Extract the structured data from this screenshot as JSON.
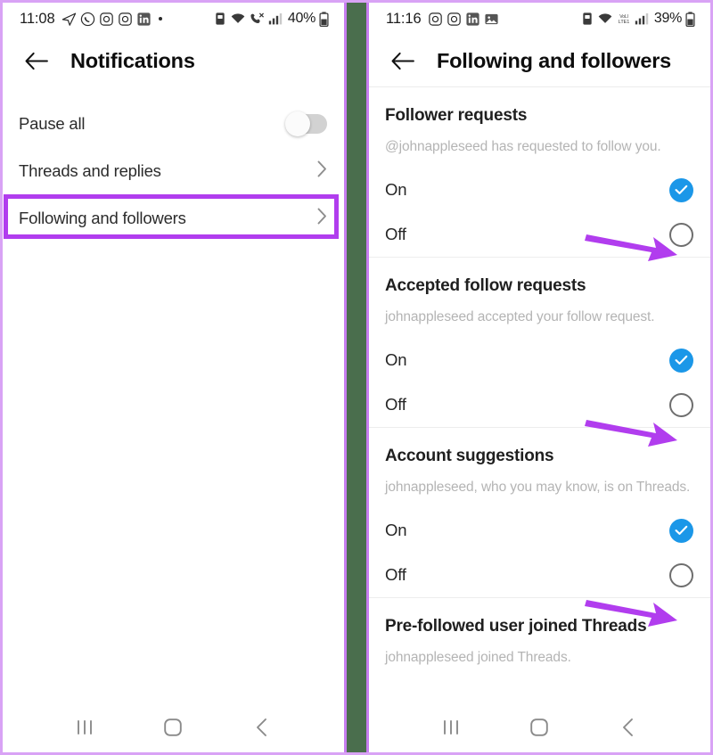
{
  "annotation": {
    "highlight_color": "#b13dee",
    "arrow_color": "#b13dee",
    "frame_color": "#d9a3f5",
    "divider_color": "#4a6e4d"
  },
  "left_phone": {
    "status_bar": {
      "time": "11:08",
      "left_icons": [
        "telegram-icon",
        "whatsapp-icon",
        "instagram-icon",
        "instagram-icon",
        "linkedin-icon",
        "dot-icon"
      ],
      "right_icons": [
        "alarm-icon",
        "wifi-icon",
        "call-mute-icon",
        "signal-icon"
      ],
      "battery": "40%"
    },
    "header": {
      "back": "back-arrow-icon",
      "title": "Notifications"
    },
    "rows": [
      {
        "label": "Pause all",
        "control": "toggle",
        "toggle_on": false,
        "highlighted": false
      },
      {
        "label": "Threads and replies",
        "control": "chevron",
        "highlighted": false
      },
      {
        "label": "Following and followers",
        "control": "chevron",
        "highlighted": true
      }
    ],
    "nav": [
      "recents-icon",
      "home-icon",
      "back-icon"
    ]
  },
  "right_phone": {
    "status_bar": {
      "time": "11:16",
      "left_icons": [
        "instagram-icon",
        "instagram-icon",
        "linkedin-icon",
        "photo-icon"
      ],
      "right_icons": [
        "alarm-icon",
        "wifi-icon",
        "volte-icon",
        "signal-icon"
      ],
      "battery": "39%"
    },
    "header": {
      "back": "back-arrow-icon",
      "title": "Following and followers"
    },
    "sections": [
      {
        "title": "Follower requests",
        "description": "@johnappleseed has requested to follow you.",
        "options": [
          {
            "label": "On",
            "selected": true
          },
          {
            "label": "Off",
            "selected": false
          }
        ],
        "arrow_points_to": "Off"
      },
      {
        "title": "Accepted follow requests",
        "description": "johnappleseed accepted your follow request.",
        "options": [
          {
            "label": "On",
            "selected": true
          },
          {
            "label": "Off",
            "selected": false
          }
        ],
        "arrow_points_to": "Off"
      },
      {
        "title": "Account suggestions",
        "description": "johnappleseed, who you may know, is on Threads.",
        "options": [
          {
            "label": "On",
            "selected": true
          },
          {
            "label": "Off",
            "selected": false
          }
        ],
        "arrow_points_to": "Off"
      },
      {
        "title": "Pre-followed user joined Threads",
        "description": "johnappleseed joined Threads.",
        "options": [],
        "partially_visible": true
      }
    ],
    "nav": [
      "recents-icon",
      "home-icon",
      "back-icon"
    ]
  }
}
